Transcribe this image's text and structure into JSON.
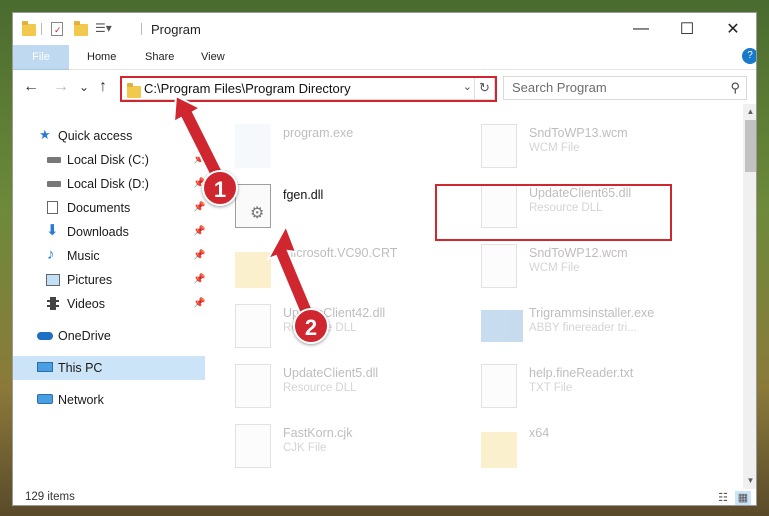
{
  "window": {
    "title": "Program",
    "controls": {
      "minimize": "—",
      "maximize": "☐",
      "close": "✕"
    }
  },
  "ribbon": {
    "tabs": [
      "File",
      "Home",
      "Share",
      "View"
    ],
    "help": "?"
  },
  "address": {
    "path": "C:\\Program Files\\Program Directory",
    "refresh": "↻",
    "dropdown": "⌄"
  },
  "search": {
    "placeholder": "Search Program"
  },
  "nav": {
    "back": "←",
    "forward": "→",
    "recent": "⌄",
    "up": "↑",
    "items": [
      {
        "label": "Quick access",
        "icon": "star-icon"
      },
      {
        "label": "Local Disk (C:)",
        "icon": "drive-icon",
        "pinned": "📌"
      },
      {
        "label": "Local Disk (D:)",
        "icon": "drive-icon",
        "pinned": "📌"
      },
      {
        "label": "Documents",
        "icon": "documents-icon",
        "pinned": "📌"
      },
      {
        "label": "Downloads",
        "icon": "download-icon",
        "pinned": "📌"
      },
      {
        "label": "Music",
        "icon": "music-icon",
        "pinned": "📌"
      },
      {
        "label": "Pictures",
        "icon": "pictures-icon",
        "pinned": "📌"
      },
      {
        "label": "Videos",
        "icon": "videos-icon",
        "pinned": "📌"
      },
      {
        "label": "OneDrive",
        "icon": "cloud-icon"
      },
      {
        "label": "This PC",
        "icon": "pc-icon"
      },
      {
        "label": "Network",
        "icon": "network-icon"
      }
    ]
  },
  "files": [
    {
      "name": "program.exe",
      "type": ""
    },
    {
      "name": "SndToWP13.wcm",
      "type": "WCM File"
    },
    {
      "name": "fgen.dll",
      "type": ""
    },
    {
      "name": "UpdateClient65.dll",
      "type": "Resource DLL"
    },
    {
      "name": "Microsoft.VC90.CRT",
      "type": ""
    },
    {
      "name": "SndToWP12.wcm",
      "type": "WCM File"
    },
    {
      "name": "UpdateClient42.dll",
      "type": "Resource DLL"
    },
    {
      "name": "Trigrammsinstaller.exe",
      "type": "ABBY finereader tri..."
    },
    {
      "name": "UpdateClient5.dll",
      "type": "Resource DLL"
    },
    {
      "name": "help.fineReader.txt",
      "type": "TXT File"
    },
    {
      "name": "FastKorn.cjk",
      "type": "CJK File"
    },
    {
      "name": "x64",
      "type": ""
    }
  ],
  "status": {
    "count": "129 items"
  },
  "annotations": {
    "step1": "1",
    "step2": "2"
  },
  "colors": {
    "accent": "#1979ca",
    "annotation": "#d0262f",
    "selected": "#cce4f7"
  }
}
